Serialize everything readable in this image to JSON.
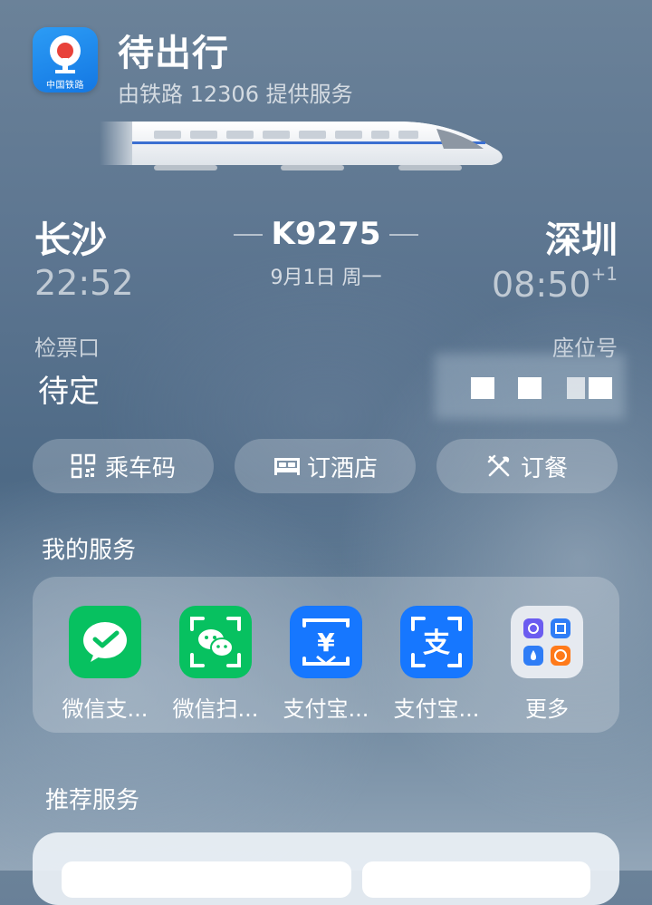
{
  "header": {
    "icon_caption": "中国铁路",
    "title": "待出行",
    "subtitle": "由铁路 12306 提供服务"
  },
  "trip": {
    "from_city": "长沙",
    "to_city": "深圳",
    "train_number": "K9275",
    "date": "9月1日 周一",
    "departure_time": "22:52",
    "arrival_time": "08:50",
    "arrival_day_offset": "+1",
    "gate_label": "检票口",
    "gate_value": "待定",
    "seat_label": "座位号"
  },
  "actions": [
    {
      "label": "乘车码",
      "icon": "qr-code-icon"
    },
    {
      "label": "订酒店",
      "icon": "bed-icon"
    },
    {
      "label": "订餐",
      "icon": "utensils-icon"
    }
  ],
  "my_services": {
    "title": "我的服务",
    "items": [
      {
        "label": "微信支...",
        "icon": "wechat-pay-icon",
        "color": "#07c160"
      },
      {
        "label": "微信扫...",
        "icon": "wechat-scan-icon",
        "color": "#07c160"
      },
      {
        "label": "支付宝...",
        "icon": "alipay-pay-icon",
        "color": "#1677ff"
      },
      {
        "label": "支付宝...",
        "icon": "alipay-scan-icon",
        "color": "#1677ff"
      },
      {
        "label": "更多",
        "icon": "more-apps-icon",
        "color": "#e6eaf0"
      }
    ]
  },
  "recommended": {
    "title": "推荐服务"
  }
}
